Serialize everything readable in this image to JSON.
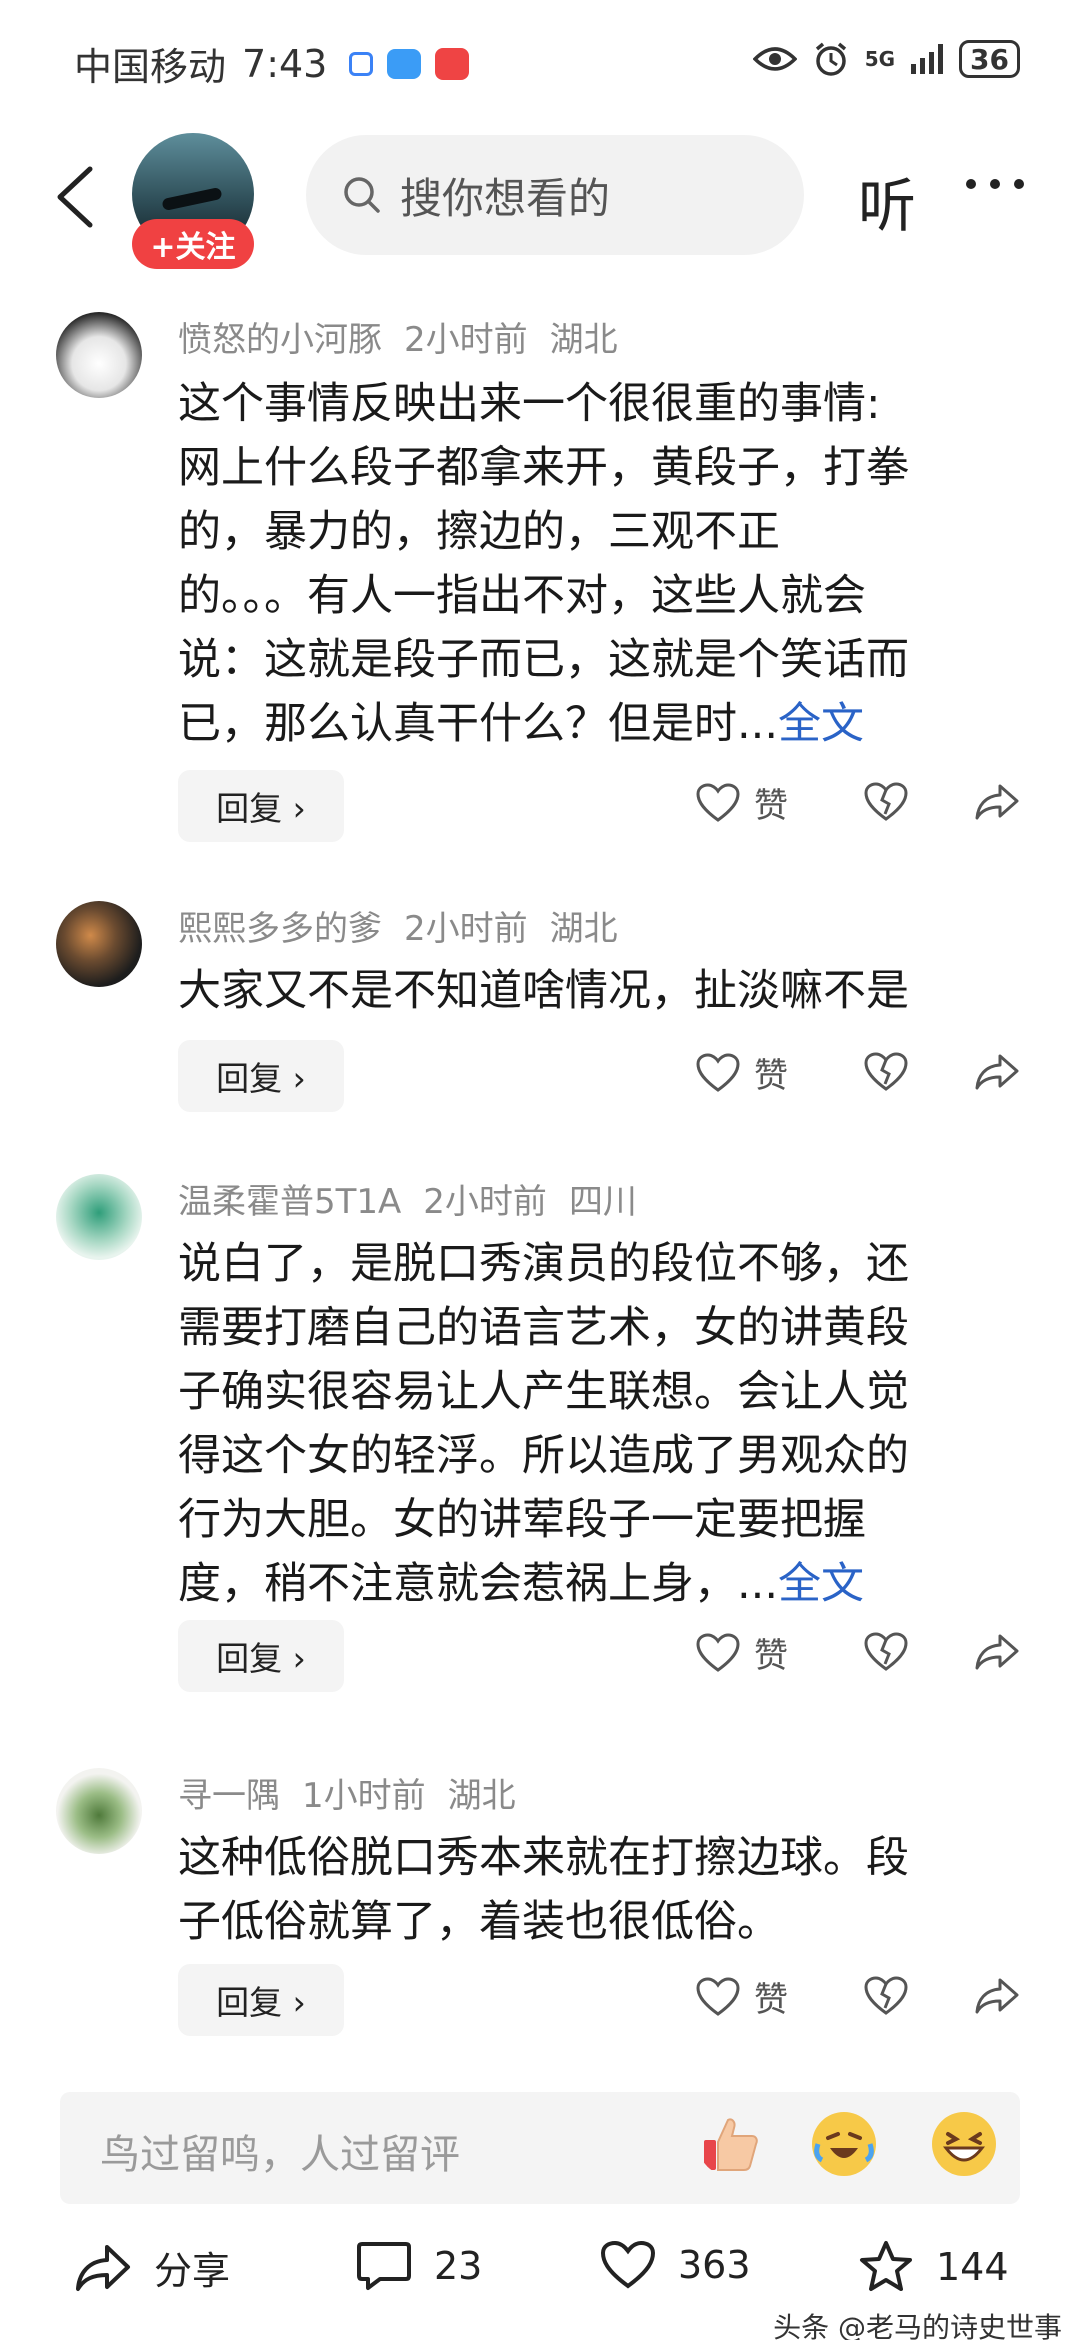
{
  "status_bar": {
    "carrier": "中国移动",
    "time": "7:43",
    "network": "5G",
    "battery": "36"
  },
  "header": {
    "follow_label": "+关注",
    "search_placeholder": "搜你想看的",
    "listen_label": "听"
  },
  "comments": [
    {
      "username": "愤怒的小河豚",
      "time": "2小时前",
      "location": "湖北",
      "lines": [
        "这个事情反映出来一个很很重的事情:",
        "网上什么段子都拿来开，黄段子，打拳",
        "的，暴力的，擦边的，三观不正",
        "的。。。有人一指出不对，这些人就会",
        "说：这就是段子而已，这就是个笑话而",
        "已，那么认真干什么？但是时..."
      ],
      "full_text_label": "全文",
      "reply_label": "回复 ›",
      "like_label": "赞"
    },
    {
      "username": "熙熙多多的爹",
      "time": "2小时前",
      "location": "湖北",
      "lines": [
        "大家又不是不知道啥情况，扯淡嘛不是"
      ],
      "reply_label": "回复 ›",
      "like_label": "赞"
    },
    {
      "username": "温柔霍普5T1A",
      "time": "2小时前",
      "location": "四川",
      "lines": [
        "说白了，是脱口秀演员的段位不够，还",
        "需要打磨自己的语言艺术，女的讲黄段",
        "子确实很容易让人产生联想。会让人觉",
        "得这个女的轻浮。所以造成了男观众的",
        "行为大胆。女的讲荤段子一定要把握",
        "度，稍不注意就会惹祸上身，..."
      ],
      "full_text_label": "全文",
      "reply_label": "回复 ›",
      "like_label": "赞"
    },
    {
      "username": "寻一隅",
      "time": "1小时前",
      "location": "湖北",
      "lines": [
        "这种低俗脱口秀本来就在打擦边球。段",
        "子低俗就算了，着装也很低俗。"
      ],
      "reply_label": "回复 ›",
      "like_label": "赞"
    }
  ],
  "input": {
    "placeholder": "鸟过留鸣，人过留评"
  },
  "bottom_bar": {
    "share_label": "分享",
    "comment_count": "23",
    "like_count": "363",
    "favorite_count": "144"
  },
  "watermark": "头条 @老马的诗史世事",
  "icons": {
    "back": "chevron-left-icon",
    "search": "search-icon",
    "more": "more-dots-icon",
    "like": "heart-icon",
    "dislike": "broken-heart-icon",
    "share": "share-arrow-icon",
    "comment": "comment-bubble-icon",
    "favorite": "star-icon"
  },
  "colors": {
    "accent_red": "#f04142",
    "link_blue": "#2a63c7"
  }
}
